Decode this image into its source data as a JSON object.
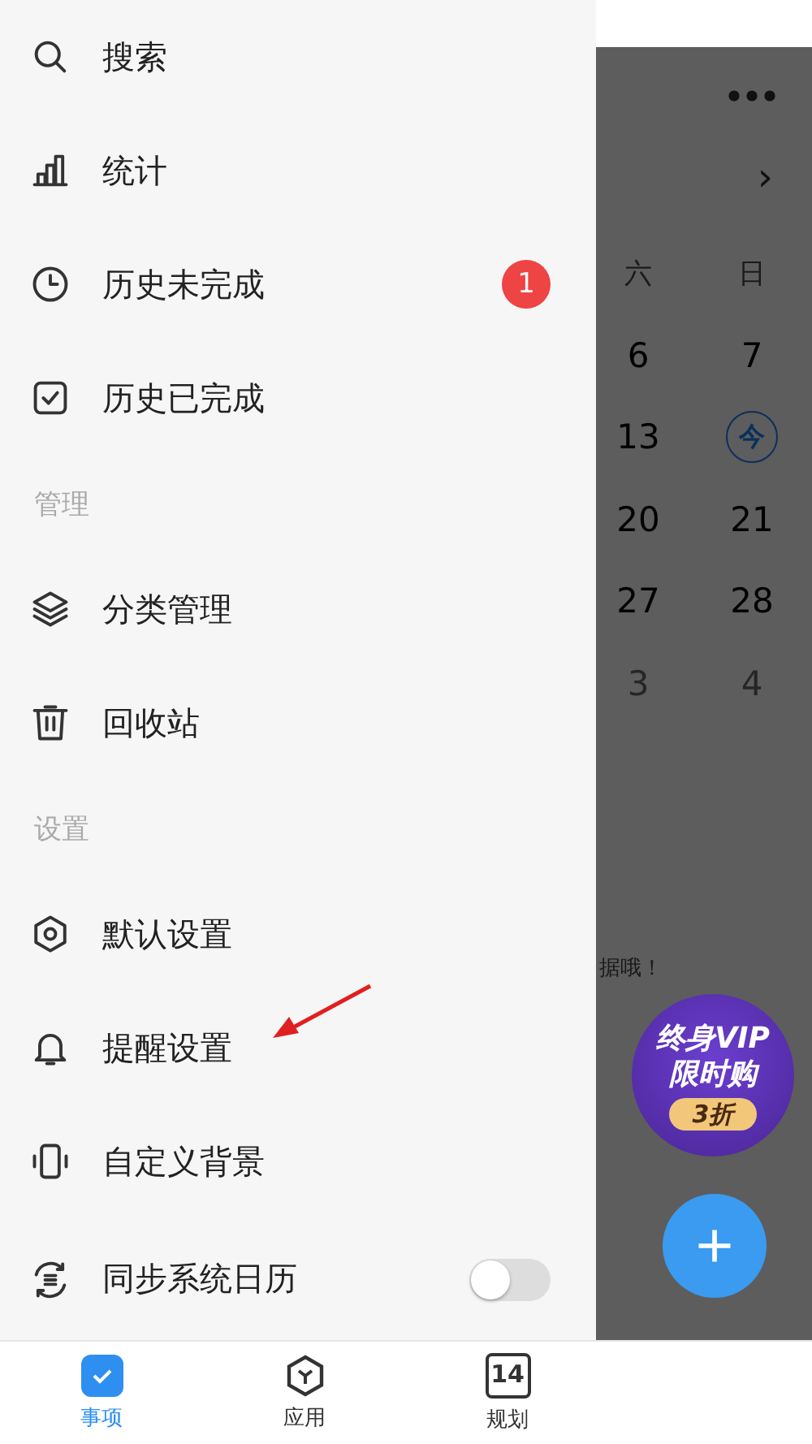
{
  "drawer": {
    "items": [
      {
        "kind": "item",
        "label": "搜索"
      },
      {
        "kind": "item",
        "label": "统计"
      },
      {
        "kind": "badge",
        "label": "历史未完成",
        "badge": "1"
      },
      {
        "kind": "item",
        "label": "历史已完成"
      },
      {
        "kind": "section",
        "label": "管理"
      },
      {
        "kind": "item",
        "label": "分类管理"
      },
      {
        "kind": "item",
        "label": "回收站"
      },
      {
        "kind": "section",
        "label": "设置"
      },
      {
        "kind": "item",
        "label": "默认设置"
      },
      {
        "kind": "item",
        "label": "提醒设置"
      },
      {
        "kind": "item",
        "label": "自定义背景"
      },
      {
        "kind": "toggle",
        "label": "同步系统日历",
        "on": false
      }
    ]
  },
  "calendar": {
    "next": "›",
    "weekdays": [
      "六",
      "日"
    ],
    "rows": [
      [
        {
          "text": "6",
          "today": false,
          "muted": false
        },
        {
          "text": "7",
          "today": false,
          "muted": false
        }
      ],
      [
        {
          "text": "13",
          "today": false,
          "muted": false
        },
        {
          "text": "今",
          "today": true,
          "muted": false
        }
      ],
      [
        {
          "text": "20",
          "today": false,
          "muted": false
        },
        {
          "text": "21",
          "today": false,
          "muted": false
        }
      ],
      [
        {
          "text": "27",
          "today": false,
          "muted": false
        },
        {
          "text": "28",
          "today": false,
          "muted": false
        }
      ],
      [
        {
          "text": "3",
          "today": false,
          "muted": true
        },
        {
          "text": "4",
          "today": false,
          "muted": true
        }
      ]
    ],
    "hint": "据哦！"
  },
  "promo": {
    "lines": [
      "终身VIP",
      "限时购"
    ],
    "discount": "3折"
  },
  "tabs": [
    {
      "label": "事项",
      "selected": true
    },
    {
      "label": "应用",
      "selected": false
    },
    {
      "label": "规划",
      "selected": false,
      "icon_text": "14"
    }
  ]
}
